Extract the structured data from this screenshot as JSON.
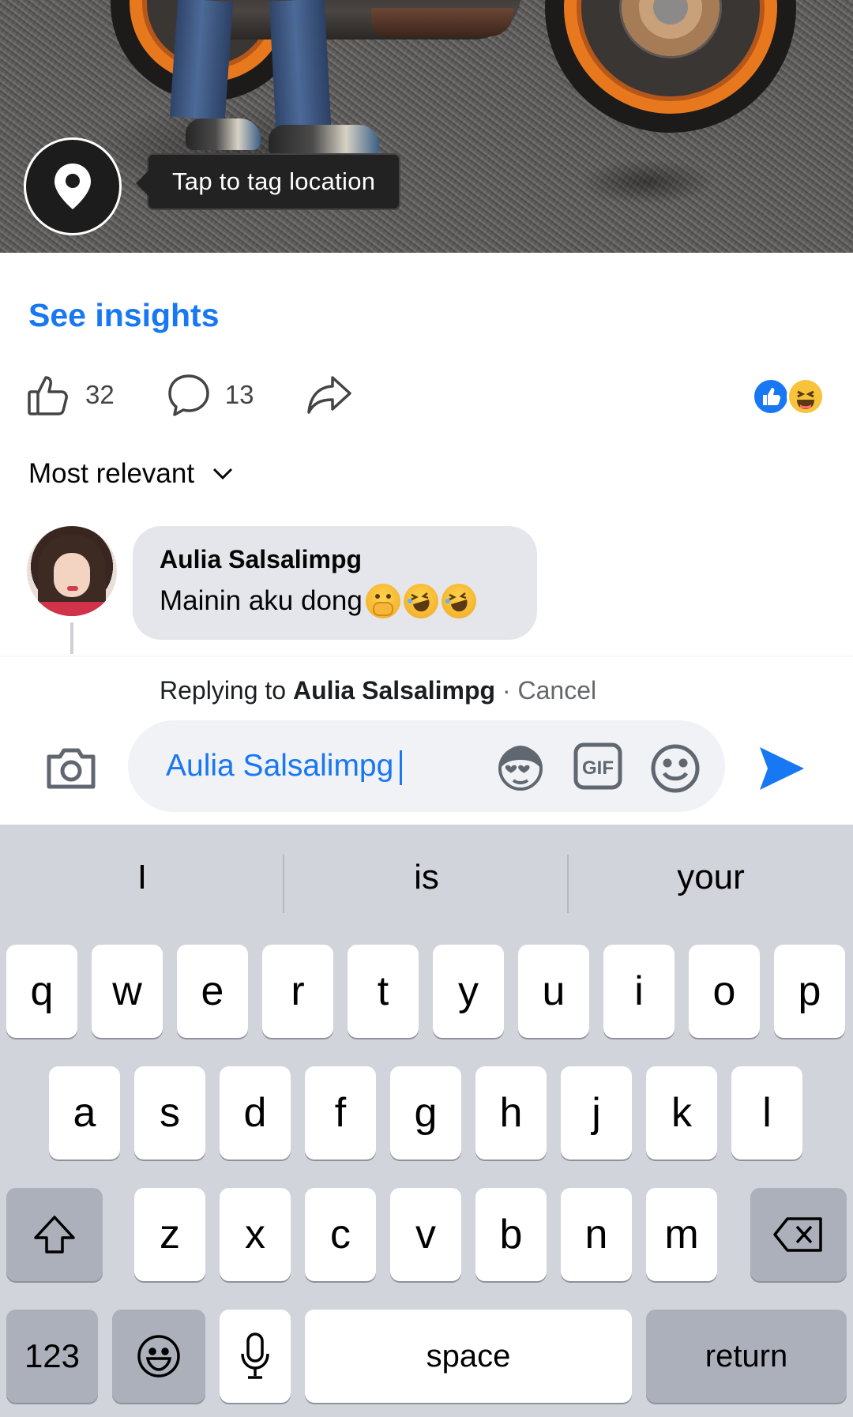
{
  "photo": {
    "tag_location_label": "Tap to tag location"
  },
  "post": {
    "see_insights": "See insights",
    "likes_count": "32",
    "comments_count": "13",
    "sort_label": "Most relevant"
  },
  "comment": {
    "author": "Aulia Salsalimpg",
    "text": "Mainin aku dong"
  },
  "composer": {
    "replying_prefix": "Replying to",
    "replying_to": "Aulia Salsalimpg",
    "separator": "·",
    "cancel_label": "Cancel",
    "input_value": "Aulia Salsalimpg",
    "gif_label": "GIF"
  },
  "keyboard": {
    "suggestions": [
      "I",
      "is",
      "your"
    ],
    "row1": [
      "q",
      "w",
      "e",
      "r",
      "t",
      "y",
      "u",
      "i",
      "o",
      "p"
    ],
    "row2": [
      "a",
      "s",
      "d",
      "f",
      "g",
      "h",
      "j",
      "k",
      "l"
    ],
    "row3": [
      "z",
      "x",
      "c",
      "v",
      "b",
      "n",
      "m"
    ],
    "numbers_label": "123",
    "space_label": "space",
    "return_label": "return"
  },
  "colors": {
    "accent": "#1877f2",
    "keyboard_bg": "#d1d4db"
  }
}
